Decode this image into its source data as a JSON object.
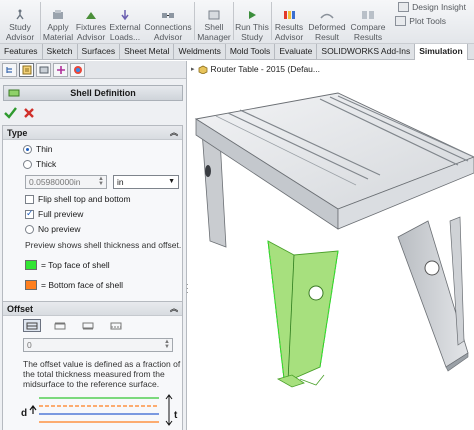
{
  "ribbon": {
    "buttons": [
      {
        "label1": "Study",
        "label2": "Advisor"
      },
      {
        "label1": "Apply",
        "label2": "Material"
      },
      {
        "label1": "Fixtures",
        "label2": "Advisor"
      },
      {
        "label1": "External",
        "label2": "Loads..."
      },
      {
        "label1": "Connections",
        "label2": "Advisor"
      },
      {
        "label1": "Shell",
        "label2": "Manager"
      },
      {
        "label1": "Run This",
        "label2": "Study"
      },
      {
        "label1": "Results",
        "label2": "Advisor"
      },
      {
        "label1": "Deformed",
        "label2": "Result"
      },
      {
        "label1": "Compare",
        "label2": "Results"
      }
    ],
    "design_insight": "Design Insight",
    "plot_tools": "Plot Tools"
  },
  "tabs": [
    "Features",
    "Sketch",
    "Surfaces",
    "Sheet Metal",
    "Weldments",
    "Mold Tools",
    "Evaluate",
    "SOLIDWORKS Add-Ins",
    "Simulation"
  ],
  "active_tab": "Simulation",
  "panel": {
    "title": "Shell Definition",
    "type_group": {
      "title": "Type",
      "thin": "Thin",
      "thick": "Thick",
      "thickness_value": "0.05980000in",
      "unit": "in",
      "flip": "Flip shell top and bottom",
      "full_preview": "Full preview",
      "no_preview": "No preview",
      "preview_note": "Preview shows shell thickness and offset.",
      "top_face": "= Top face of shell",
      "bottom_face": "= Bottom face of shell"
    },
    "offset_group": {
      "title": "Offset",
      "value": "0",
      "note_line1": "The offset value is defined as a fraction of",
      "note_line2": "the total thickness measured from the",
      "note_line3": "midsurface to the reference surface.",
      "d_label": "d",
      "t_label": "t"
    }
  },
  "viewport": {
    "tree_title": "Router Table - 2015  (Defau..."
  },
  "colors": {
    "top_face": "#33e633",
    "bottom_face": "#ff7f1e",
    "selection": "#99dd77"
  }
}
